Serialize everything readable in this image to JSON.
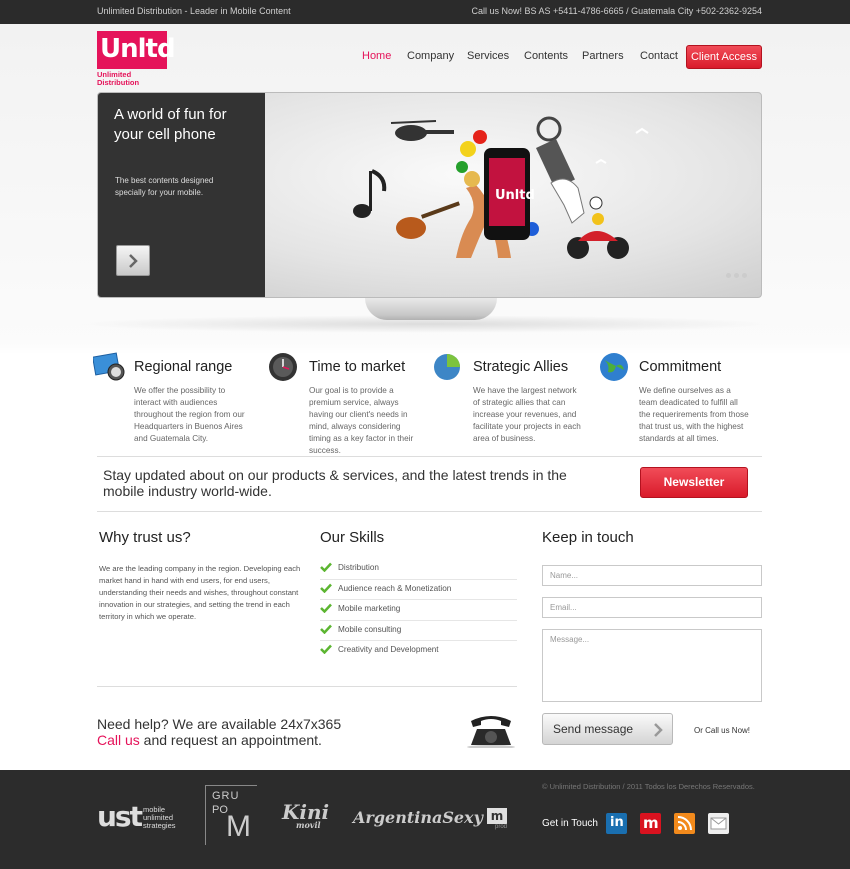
{
  "topbar": {
    "tagline": "Unlimited Distribution - Leader in Mobile Content",
    "contact": "Call us Now!  BS AS +5411-4786-6665 / Guatemala City +502-2362-9254"
  },
  "logo": {
    "mark": "Unltd",
    "sub_line1": "Unlimited",
    "sub_line2": "Distribution"
  },
  "nav": {
    "items": [
      "Home",
      "Company",
      "Services",
      "Contents",
      "Partners",
      "Contact"
    ],
    "active": "Home",
    "client_access": "Client Access"
  },
  "hero": {
    "title": "A world of fun for your cell phone",
    "subtitle": "The best contents designed specially for your mobile."
  },
  "features": [
    {
      "title": "Regional range",
      "text": "We offer the possibility to interact with audiences throughout the region from our Headquarters in Buenos Aires and Guatemala City.",
      "icon": "map-compass-icon"
    },
    {
      "title": "Time to market",
      "text": "Our goal is to provide a premium service, always having our client's needs in mind, always considering timing as a key factor in their success.",
      "icon": "clock-icon"
    },
    {
      "title": "Strategic Allies",
      "text": "We have the largest network of strategic allies that can increase your revenues, and facilitate your projects in each area of business.",
      "icon": "pie-chart-icon"
    },
    {
      "title": "Commitment",
      "text": "We define ourselves as a team deadicated to fulfill all the requerirements from those that trust us, with the highest standards at all times.",
      "icon": "globe-icon"
    }
  ],
  "newsletter": {
    "text": "Stay updated about on our products & services, and the latest trends in the mobile industry world-wide.",
    "button": "Newsletter"
  },
  "why": {
    "title": "Why trust us?",
    "text": "We are the leading company in the region. Developing each market hand in hand with end users, for end users, understanding their needs and wishes, throughout constant innovation in our strategies, and setting the trend in each territory in which we operate."
  },
  "skills": {
    "title": "Our Skills",
    "items": [
      "Distribution",
      "Audience reach & Monetization",
      "Mobile marketing",
      "Mobile consulting",
      "Creativity and Development"
    ]
  },
  "contact": {
    "title": "Keep in touch",
    "name_placeholder": "Name...",
    "email_placeholder": "Email...",
    "message_placeholder": "Message...",
    "send": "Send message",
    "or_call": "Or Call us Now!"
  },
  "help": {
    "line1": "Need help? We are available 24x7x365",
    "call_us": "Call us",
    "line2_rest": " and request an appointment."
  },
  "footer": {
    "copyright": "© Unlimited Distribution  / 2011 Todos los Derechos Reservados.",
    "get_in_touch": "Get in Touch",
    "brands": [
      "ust mobile unlimited strategies",
      "GRUPO M",
      "Kini movil",
      "ArgentinaSexy",
      "m prod"
    ],
    "social": [
      "linkedin-icon",
      "m-icon",
      "rss-icon",
      "email-icon"
    ]
  },
  "colors": {
    "accent": "#e5135a",
    "button_red": "#e0232f",
    "dark": "#2b2b2b"
  }
}
